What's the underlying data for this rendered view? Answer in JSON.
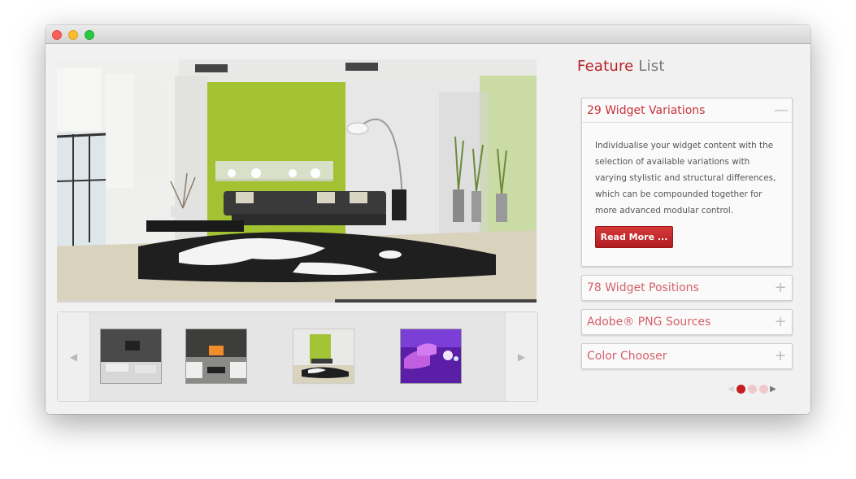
{
  "window": {
    "controls": [
      "close",
      "minimize",
      "zoom"
    ]
  },
  "hero": {
    "progress": 0.58
  },
  "thumbnails": {
    "prev_icon": "chevron-left-icon",
    "next_icon": "chevron-right-icon",
    "items": [
      {
        "name": "dark-living-room-tv-thumbnail",
        "active": false
      },
      {
        "name": "fireplace-lounge-thumbnail",
        "active": false
      },
      {
        "name": "green-wall-living-room-thumbnail",
        "active": true
      },
      {
        "name": "purple-lit-chairs-thumbnail",
        "active": false
      }
    ]
  },
  "feature": {
    "title_word1": "Feature",
    "title_word2": "List",
    "items": [
      {
        "title": "29 Widget Variations",
        "toggle": "—",
        "open": true,
        "body": "Individualise your widget content with the selection of available variations with varying stylistic and structural differences, which can be compounded together for more advanced modular control.",
        "button": "Read More ..."
      },
      {
        "title": "78 Widget Positions",
        "toggle": "+",
        "open": false
      },
      {
        "title": "Adobe® PNG Sources",
        "toggle": "+",
        "open": false
      },
      {
        "title": "Color Chooser",
        "toggle": "+",
        "open": false
      }
    ]
  },
  "pager": {
    "prev": "◀",
    "next": "▶",
    "pages": 3,
    "current": 1
  },
  "colors": {
    "accent": "#c51f24",
    "title_red": "#b72025",
    "heading_gray": "#777777",
    "panel_bg": "#f1f1f1"
  }
}
